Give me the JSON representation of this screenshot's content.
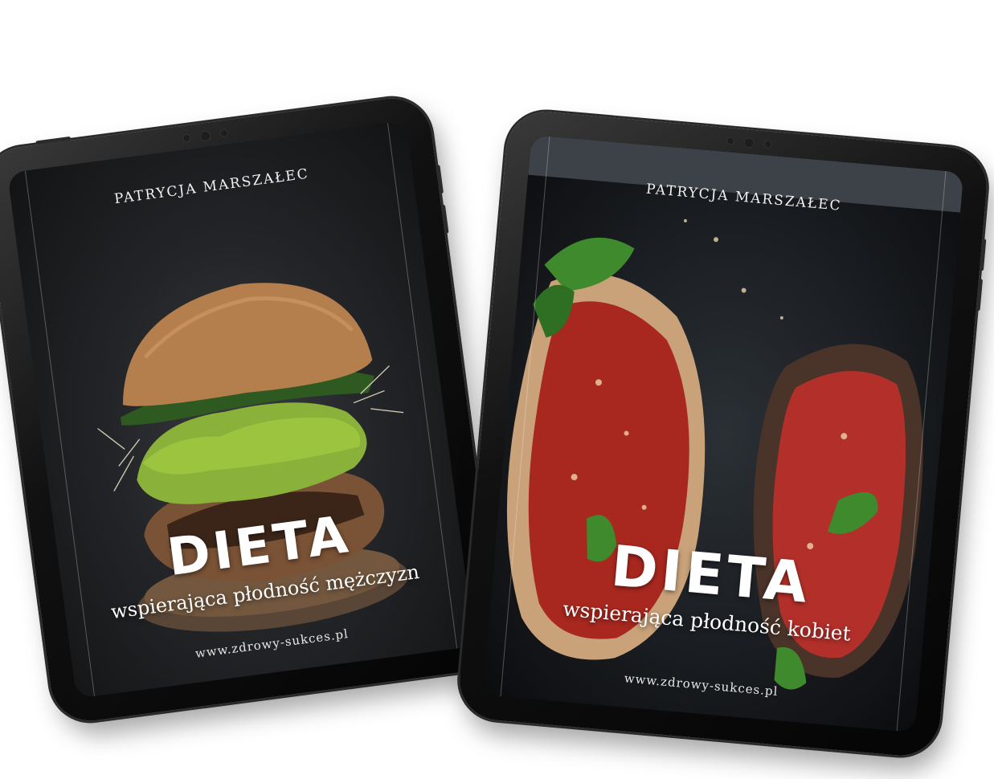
{
  "tablets": [
    {
      "author": "PATRYCJA MARSZAŁEC",
      "title": "DIETA",
      "subtitle": "wspierająca płodność mężczyzn",
      "website": "www.zdrowy-sukces.pl",
      "image": "burger-icon"
    },
    {
      "author": "PATRYCJA MARSZAŁEC",
      "title": "DIETA",
      "subtitle": "wspierająca płodność kobiet",
      "website": "www.zdrowy-sukces.pl",
      "image": "stuffed-eggplant-icon"
    }
  ]
}
